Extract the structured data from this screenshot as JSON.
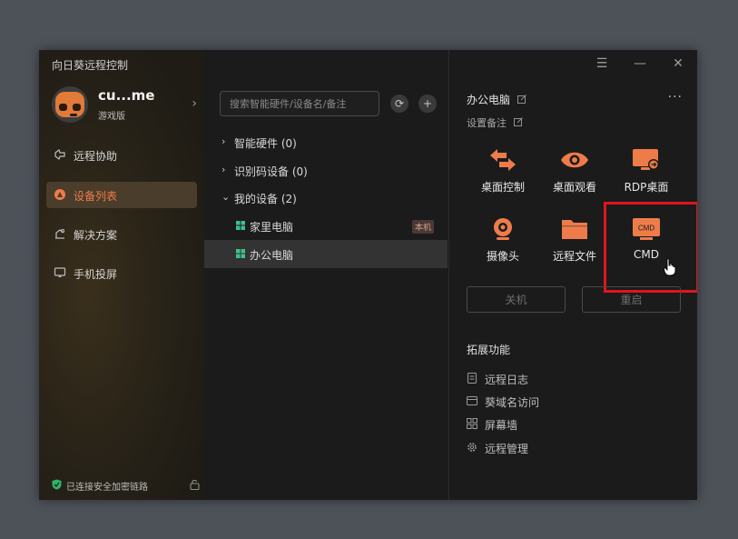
{
  "app": {
    "title": "向日葵远程控制",
    "window_controls": [
      "menu-icon",
      "minimize-icon",
      "close-icon"
    ]
  },
  "user": {
    "name": "cu...me",
    "tier": "游戏版"
  },
  "nav": {
    "items": [
      {
        "label": "远程协助",
        "icon": "remote-assist-icon",
        "active": false
      },
      {
        "label": "设备列表",
        "icon": "device-list-icon",
        "active": true
      },
      {
        "label": "解决方案",
        "icon": "solution-icon",
        "active": false
      },
      {
        "label": "手机投屏",
        "icon": "screen-cast-icon",
        "active": false
      }
    ]
  },
  "connection": {
    "label": "已连接安全加密链路"
  },
  "search": {
    "placeholder": "搜索智能硬件/设备名/备注"
  },
  "tree": {
    "groups": [
      {
        "label": "智能硬件 (0)",
        "expanded": false
      },
      {
        "label": "识别码设备 (0)",
        "expanded": false
      },
      {
        "label": "我的设备 (2)",
        "expanded": true
      }
    ],
    "devices": [
      {
        "label": "家里电脑",
        "badge": "本机",
        "selected": false
      },
      {
        "label": "办公电脑",
        "badge": "",
        "selected": true
      }
    ]
  },
  "detail": {
    "title": "办公电脑",
    "remark": "设置备注",
    "actions": [
      {
        "label": "桌面控制",
        "icon": "desktop-control-icon"
      },
      {
        "label": "桌面观看",
        "icon": "desktop-view-eye-icon"
      },
      {
        "label": "RDP桌面",
        "icon": "rdp-desktop-icon"
      },
      {
        "label": "摄像头",
        "icon": "camera-icon"
      },
      {
        "label": "远程文件",
        "icon": "folder-icon"
      },
      {
        "label": "CMD",
        "icon": "cmd-icon",
        "icon_text": "CMD"
      }
    ],
    "buttons": {
      "shutdown": "关机",
      "restart": "重启"
    },
    "extensions": {
      "title": "拓展功能",
      "items": [
        {
          "label": "远程日志",
          "icon": "log-icon"
        },
        {
          "label": "葵域名访问",
          "icon": "domain-icon"
        },
        {
          "label": "屏幕墙",
          "icon": "screen-wall-icon"
        },
        {
          "label": "远程管理",
          "icon": "gear-icon"
        }
      ]
    }
  },
  "colors": {
    "accent": "#ee7c4a",
    "highlight": "#e0141c"
  }
}
